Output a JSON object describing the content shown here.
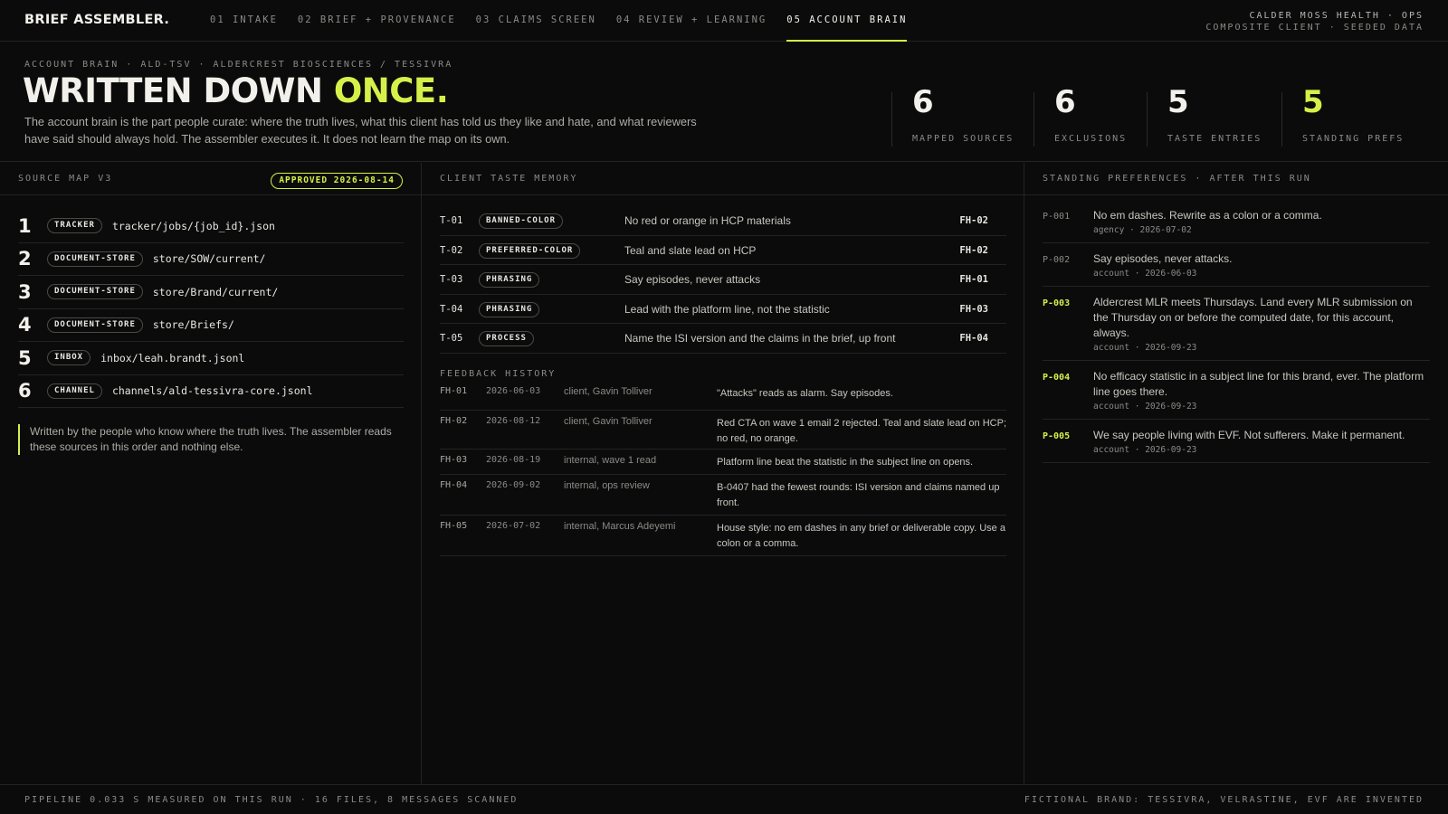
{
  "app": {
    "brand": "BRIEF ASSEMBLER."
  },
  "tabs": [
    {
      "label": "01 INTAKE"
    },
    {
      "label": "02 BRIEF + PROVENANCE"
    },
    {
      "label": "03 CLAIMS SCREEN"
    },
    {
      "label": "04 REVIEW + LEARNING"
    },
    {
      "label": "05 ACCOUNT BRAIN",
      "active": true
    }
  ],
  "top_right": {
    "line1": "CALDER MOSS HEALTH · OPS",
    "line2": "COMPOSITE CLIENT · SEEDED DATA"
  },
  "hero": {
    "breadcrumb": "ACCOUNT BRAIN · ALD-TSV · ALDERCREST BIOSCIENCES / TESSIVRA",
    "title_main": "WRITTEN DOWN ",
    "title_accent": "ONCE.",
    "lede": "The account brain is the part people curate: where the truth lives, what this client has told us they like and hate, and what reviewers have said should always hold. The assembler executes it. It does not learn the map on its own."
  },
  "stats": [
    {
      "value": "6",
      "label": "MAPPED SOURCES"
    },
    {
      "value": "6",
      "label": "EXCLUSIONS"
    },
    {
      "value": "5",
      "label": "TASTE ENTRIES"
    },
    {
      "value": "5",
      "label": "STANDING PREFS"
    }
  ],
  "source_map": {
    "title": "SOURCE MAP V3",
    "badge": "APPROVED 2026-08-14",
    "rows": [
      {
        "n": "1",
        "type": "TRACKER",
        "path": "tracker/jobs/{job_id}.json"
      },
      {
        "n": "2",
        "type": "DOCUMENT-STORE",
        "path": "store/SOW/current/"
      },
      {
        "n": "3",
        "type": "DOCUMENT-STORE",
        "path": "store/Brand/current/"
      },
      {
        "n": "4",
        "type": "DOCUMENT-STORE",
        "path": "store/Briefs/"
      },
      {
        "n": "5",
        "type": "INBOX",
        "path": "inbox/leah.brandt.jsonl"
      },
      {
        "n": "6",
        "type": "CHANNEL",
        "path": "channels/ald-tessivra-core.jsonl"
      }
    ],
    "note": "Written by the people who know where the truth lives. The assembler reads these sources in this order and nothing else."
  },
  "taste": {
    "title": "CLIENT TASTE MEMORY",
    "rows": [
      {
        "id": "T-01",
        "tag": "BANNED-COLOR",
        "text": "No red or orange in HCP materials",
        "ref": "FH-02"
      },
      {
        "id": "T-02",
        "tag": "PREFERRED-COLOR",
        "text": "Teal and slate lead on HCP",
        "ref": "FH-02"
      },
      {
        "id": "T-03",
        "tag": "PHRASING",
        "text": "Say episodes, never attacks",
        "ref": "FH-01"
      },
      {
        "id": "T-04",
        "tag": "PHRASING",
        "text": "Lead with the platform line, not the statistic",
        "ref": "FH-03"
      },
      {
        "id": "T-05",
        "tag": "PROCESS",
        "text": "Name the ISI version and the claims in the brief, up front",
        "ref": "FH-04"
      }
    ]
  },
  "feedback": {
    "title": "FEEDBACK HISTORY",
    "rows": [
      {
        "id": "FH-01",
        "date": "2026-06-03",
        "who": "client, Gavin Tolliver",
        "msg": "\"Attacks\" reads as alarm. Say episodes."
      },
      {
        "id": "FH-02",
        "date": "2026-08-12",
        "who": "client, Gavin Tolliver",
        "msg": "Red CTA on wave 1 email 2 rejected. Teal and slate lead on HCP; no red, no orange."
      },
      {
        "id": "FH-03",
        "date": "2026-08-19",
        "who": "internal, wave 1 read",
        "msg": "Platform line beat the statistic in the subject line on opens."
      },
      {
        "id": "FH-04",
        "date": "2026-09-02",
        "who": "internal, ops review",
        "msg": "B-0407 had the fewest rounds: ISI version and claims named up front."
      },
      {
        "id": "FH-05",
        "date": "2026-07-02",
        "who": "internal, Marcus Adeyemi",
        "msg": "House style: no em dashes in any brief or deliverable copy. Use a colon or a comma."
      }
    ]
  },
  "prefs": {
    "title": "STANDING PREFERENCES · AFTER THIS RUN",
    "rows": [
      {
        "id": "P-001",
        "new": false,
        "text": "No em dashes. Rewrite as a colon or a comma.",
        "meta": "agency · 2026-07-02"
      },
      {
        "id": "P-002",
        "new": false,
        "text": "Say episodes, never attacks.",
        "meta": "account · 2026-06-03"
      },
      {
        "id": "P-003",
        "new": true,
        "text": "Aldercrest MLR meets Thursdays. Land every MLR submission on the Thursday on or before the computed date, for this account, always.",
        "meta": "account · 2026-09-23"
      },
      {
        "id": "P-004",
        "new": true,
        "text": "No efficacy statistic in a subject line for this brand, ever. The platform line goes there.",
        "meta": "account · 2026-09-23"
      },
      {
        "id": "P-005",
        "new": true,
        "text": "We say people living with EVF. Not sufferers. Make it permanent.",
        "meta": "account · 2026-09-23"
      }
    ]
  },
  "footer": {
    "left": "PIPELINE 0.033 S MEASURED ON THIS RUN · 16 FILES, 8 MESSAGES SCANNED",
    "right": "FICTIONAL BRAND: TESSIVRA, VELRASTINE, EVF ARE INVENTED"
  },
  "colors": {
    "accent": "#d6f04a",
    "background": "#0b0b0b",
    "text": "#e8e6e1",
    "muted": "#8a8a86"
  }
}
